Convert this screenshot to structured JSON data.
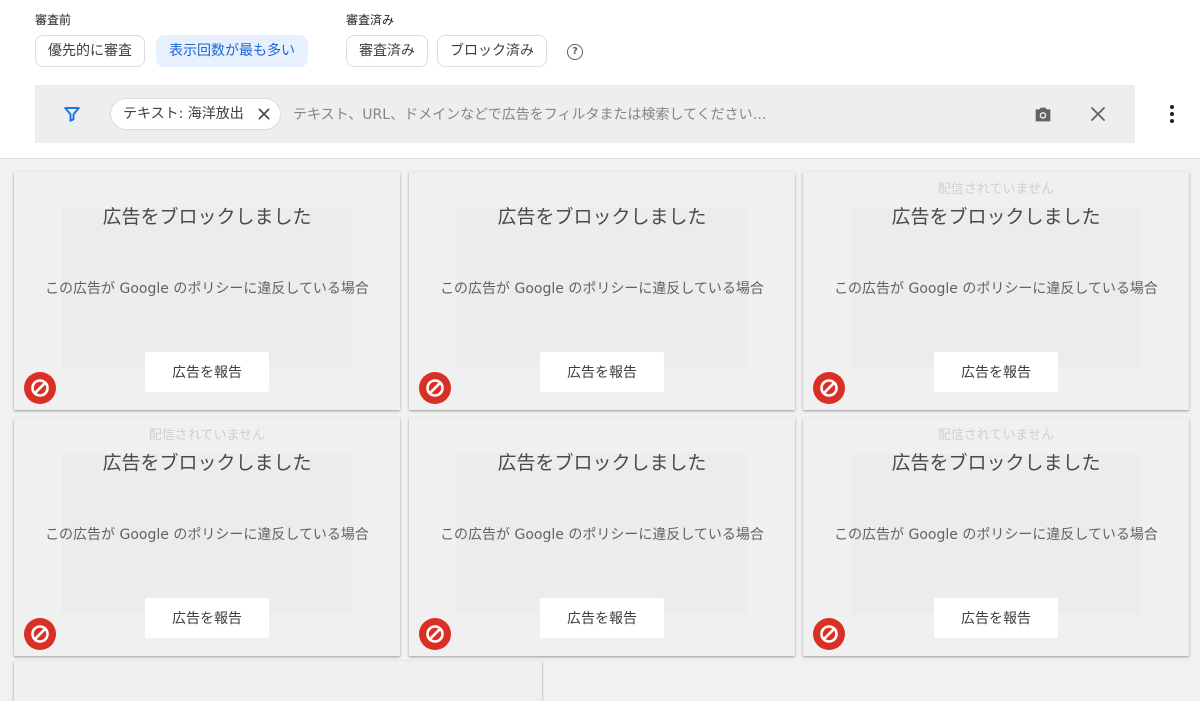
{
  "header": {
    "pre_review_label": "審査前",
    "reviewed_label": "審査済み",
    "chips": {
      "priority": "優先的に審査",
      "most_impressions": "表示回数が最も多い",
      "reviewed": "審査済み",
      "blocked": "ブロック済み"
    },
    "help_glyph": "?"
  },
  "filter_bar": {
    "active_filter": "テキスト: 海洋放出",
    "search_placeholder": "テキスト、URL、ドメインなどで広告をフィルタまたは検索してください…"
  },
  "cards": [
    {
      "not_served": "",
      "title": "広告をブロックしました",
      "description": "この広告が Google のポリシーに違反している場合",
      "report_label": "広告を報告"
    },
    {
      "not_served": "",
      "title": "広告をブロックしました",
      "description": "この広告が Google のポリシーに違反している場合",
      "report_label": "広告を報告"
    },
    {
      "not_served": "配信されていません",
      "title": "広告をブロックしました",
      "description": "この広告が Google のポリシーに違反している場合",
      "report_label": "広告を報告"
    },
    {
      "not_served": "配信されていません",
      "title": "広告をブロックしました",
      "description": "この広告が Google のポリシーに違反している場合",
      "report_label": "広告を報告"
    },
    {
      "not_served": "",
      "title": "広告をブロックしました",
      "description": "この広告が Google のポリシーに違反している場合",
      "report_label": "広告を報告"
    },
    {
      "not_served": "配信されていません",
      "title": "広告をブロックしました",
      "description": "この広告が Google のポリシーに違反している場合",
      "report_label": "広告を報告"
    }
  ],
  "colors": {
    "accent_blue": "#1a73e8",
    "selected_chip_bg": "#e8f0fe",
    "blocked_red": "#d93025"
  },
  "icons": {
    "filter": "filter-icon",
    "close": "close-icon",
    "camera": "camera-icon",
    "more": "more-vert-icon",
    "blocked": "block-icon",
    "help": "help-icon"
  }
}
